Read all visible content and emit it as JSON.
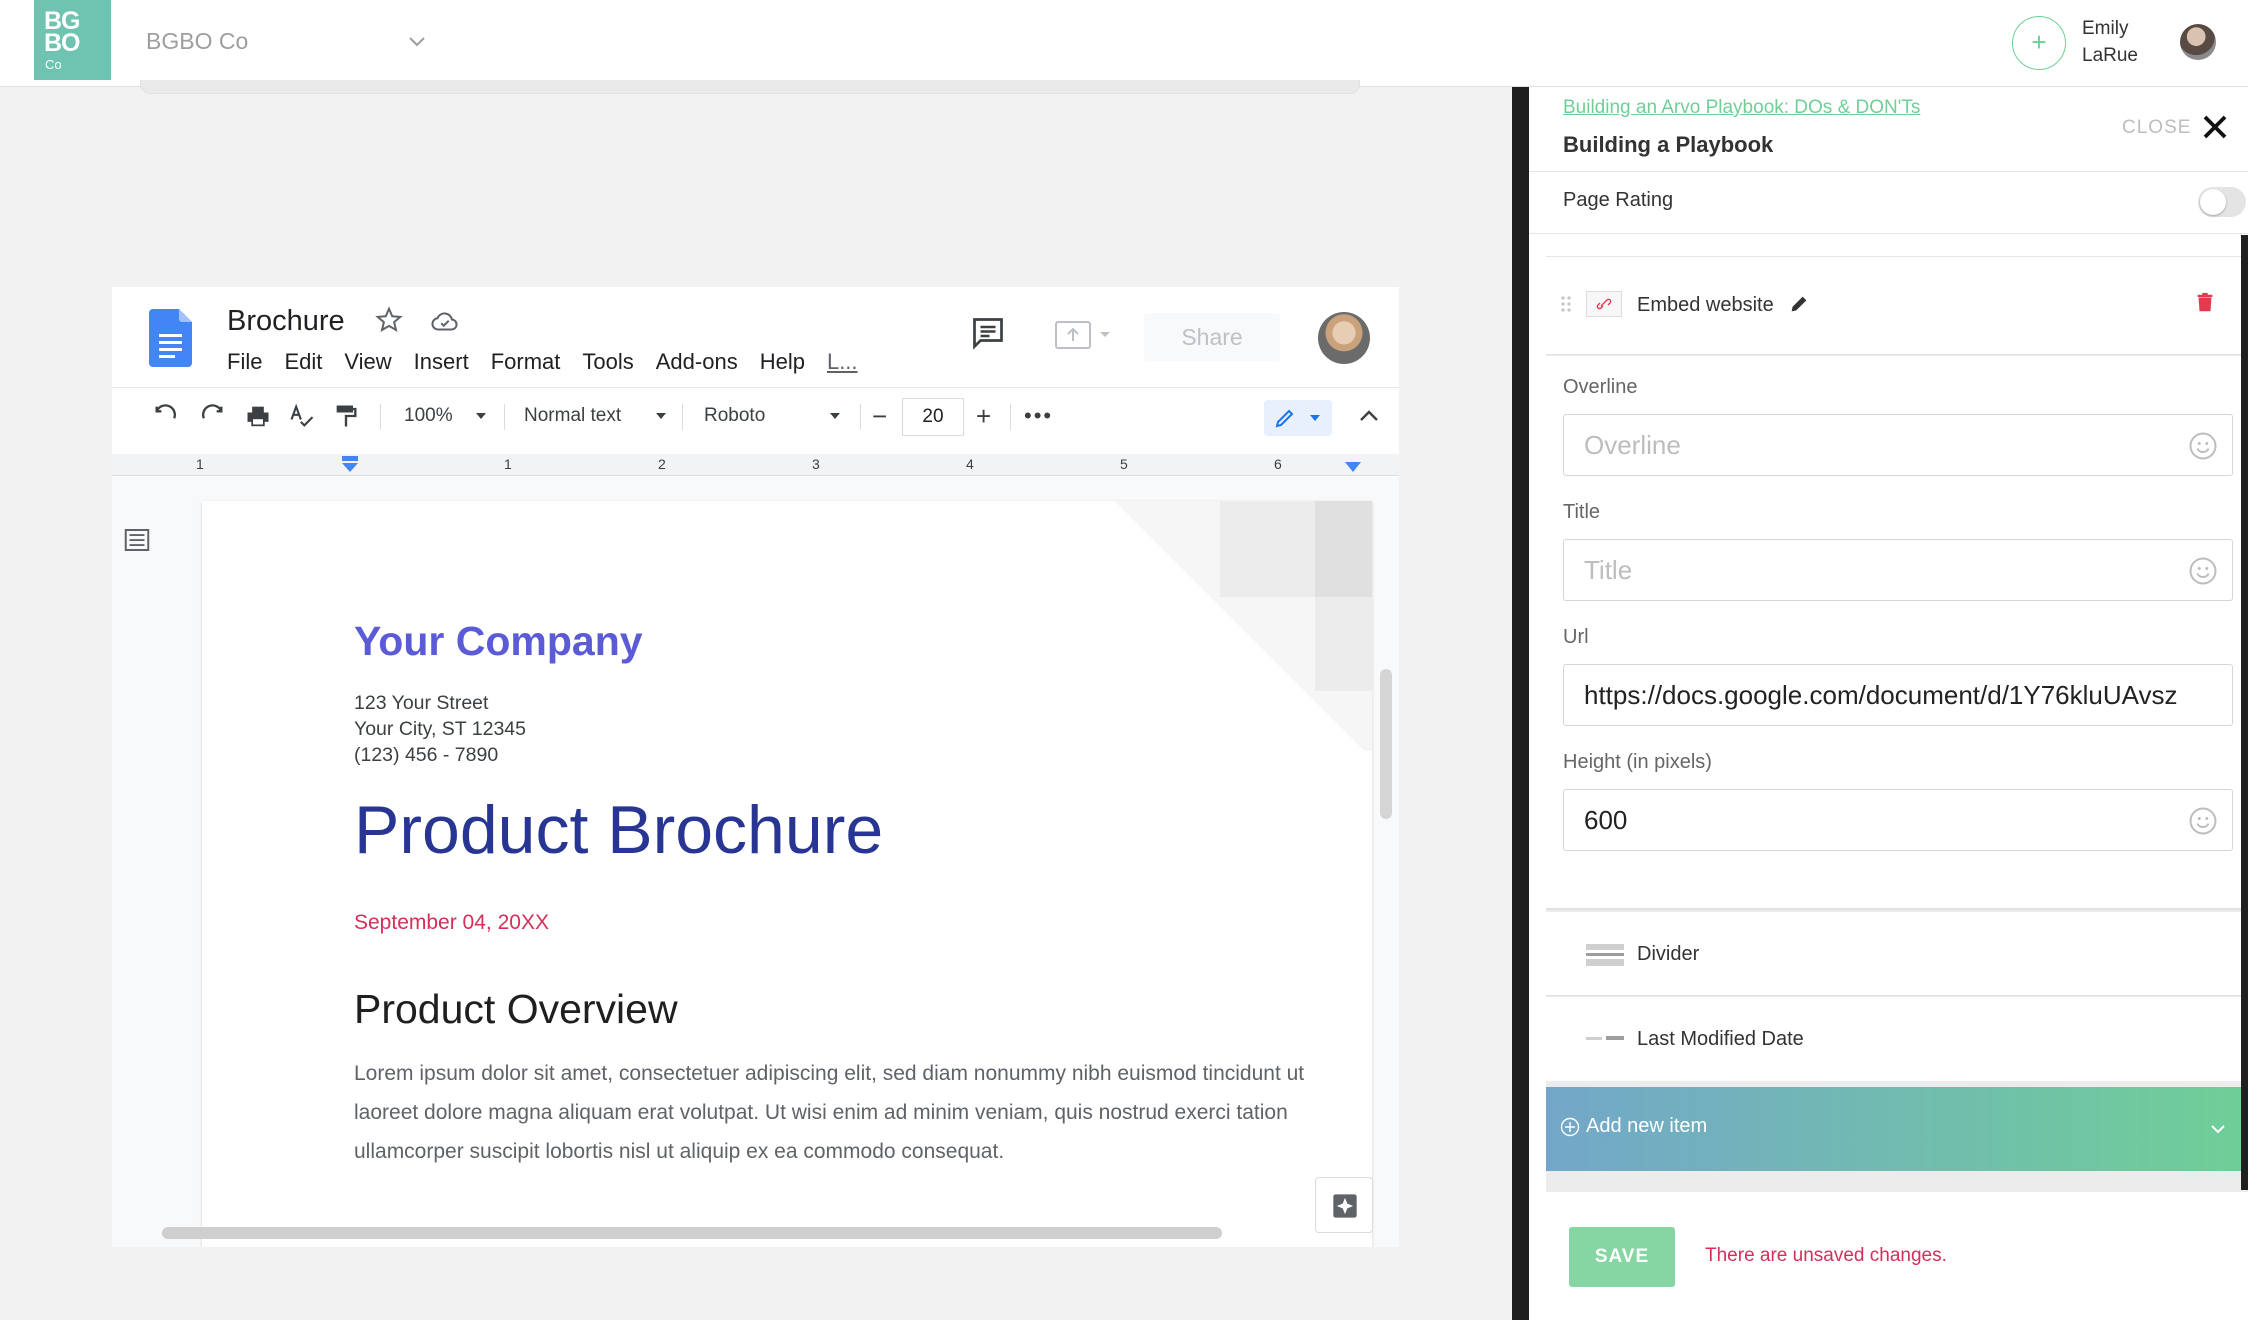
{
  "topbar": {
    "logo": {
      "line1": "BG",
      "line2": "BO",
      "line3": "Co"
    },
    "org_name": "BGBO Co",
    "user_name_first": "Emily",
    "user_name_last": "LaRue"
  },
  "doc": {
    "title": "Brochure",
    "menu": [
      "File",
      "Edit",
      "View",
      "Insert",
      "Format",
      "Tools",
      "Add-ons",
      "Help",
      "L..."
    ],
    "share_label": "Share",
    "toolbar": {
      "zoom": "100%",
      "style": "Normal text",
      "font": "Roboto",
      "font_size": "20"
    },
    "ruler_numbers": [
      "1",
      "1",
      "2",
      "3",
      "4",
      "5",
      "6"
    ],
    "company": "Your Company",
    "address": [
      "123 Your Street",
      "Your City, ST 12345",
      "(123) 456 - 7890"
    ],
    "heading": "Product Brochure",
    "date": "September 04, 20XX",
    "section_heading": "Product Overview",
    "body": "Lorem ipsum dolor sit amet, consectetuer adipiscing elit, sed diam nonummy nibh euismod tincidunt ut laoreet dolore magna aliquam erat volutpat. Ut wisi enim ad minim veniam, quis nostrud exerci tation ullamcorper suscipit lobortis nisl ut aliquip ex ea commodo consequat."
  },
  "panel": {
    "breadcrumb": "Building an Arvo Playbook: DOs & DON'Ts",
    "title": "Building a Playbook",
    "close_label": "CLOSE",
    "page_rating_label": "Page Rating",
    "page_rating_enabled": false,
    "embed_block_label": "Embed website",
    "fields": {
      "overline": {
        "label": "Overline",
        "placeholder": "Overline",
        "value": ""
      },
      "title": {
        "label": "Title",
        "placeholder": "Title",
        "value": ""
      },
      "url": {
        "label": "Url",
        "value": "https://docs.google.com/document/d/1Y76kluUAvsz"
      },
      "height": {
        "label": "Height (in pixels)",
        "value": "600"
      }
    },
    "items": [
      {
        "label": "Divider"
      },
      {
        "label": "Last Modified Date"
      }
    ],
    "add_new_label": "Add new item",
    "save_label": "SAVE",
    "unsaved_message": "There are unsaved changes."
  },
  "colors": {
    "brand_teal": "#6fc4b1",
    "accent_green": "#6fcf97",
    "doc_blue": "#283593",
    "company_purple": "#5b5bd6",
    "alert_red": "#d32f5b"
  }
}
